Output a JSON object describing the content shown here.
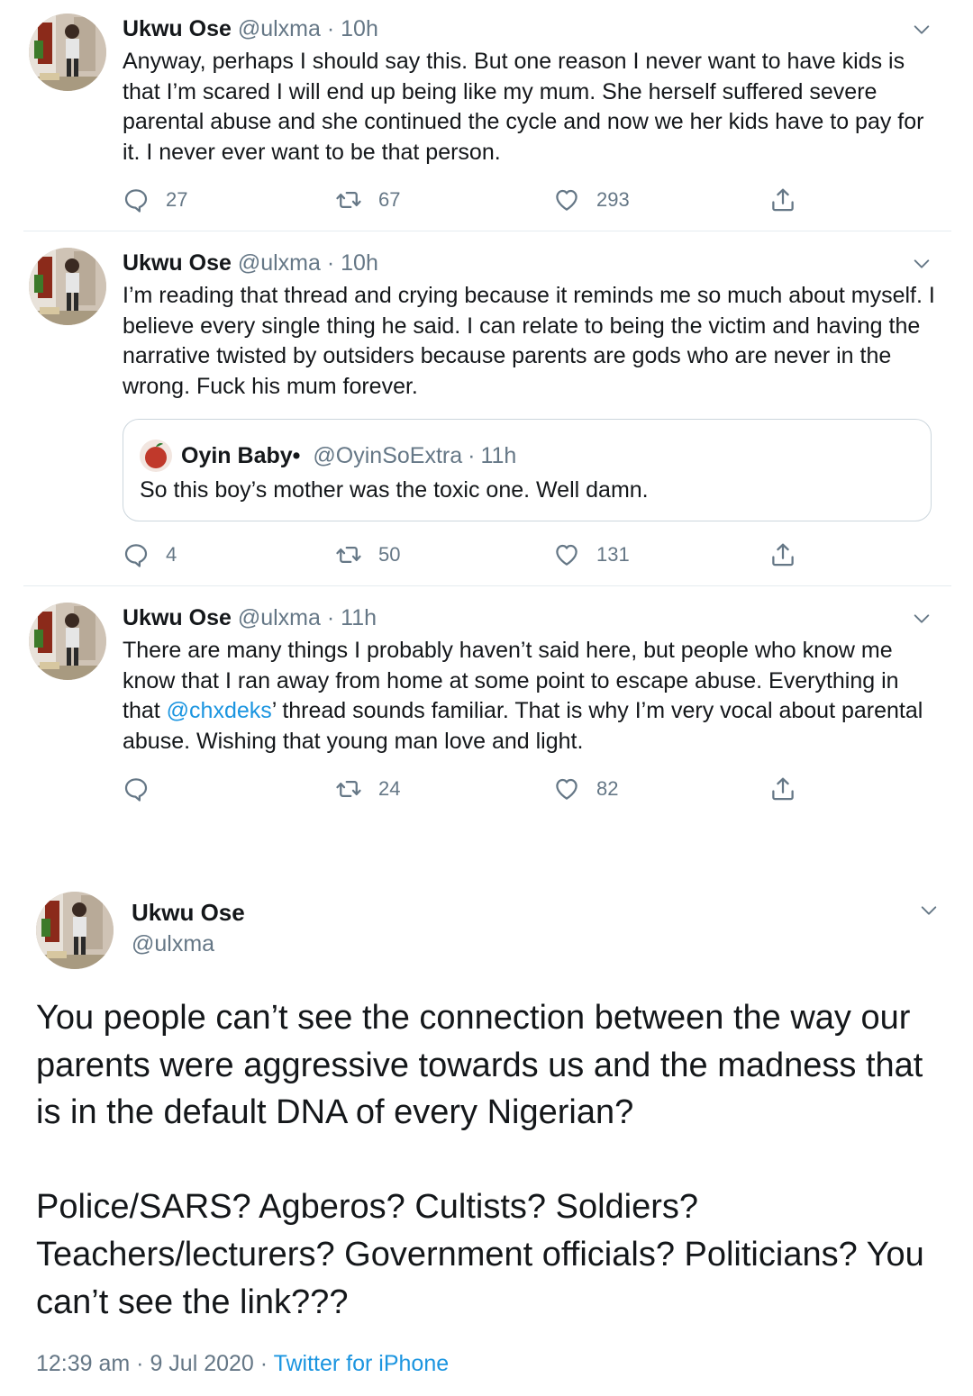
{
  "tweets": [
    {
      "name": "Ukwu Ose",
      "handle": "@ulxma",
      "time": "10h",
      "text": "Anyway, perhaps I should say this. But one reason I never want to have kids is that I’m scared I will end up being like my mum. She herself suffered severe parental abuse and she continued the cycle and now we her kids have to pay for it. I never ever want to be that person.",
      "replies": "27",
      "retweets": "67",
      "likes": "293"
    },
    {
      "name": "Ukwu Ose",
      "handle": "@ulxma",
      "time": "10h",
      "text": "I’m reading that thread and crying because it reminds me so much about myself. I believe every single thing he said. I can relate to being the victim and having the narrative twisted by outsiders because parents are gods who are never in the wrong. Fuck his mum forever.",
      "replies": "4",
      "retweets": "50",
      "likes": "131",
      "quote": {
        "name": "Oyin Baby•",
        "handle": "@OyinSoExtra",
        "time": "11h",
        "text": "So this boy’s mother was the toxic one. Well damn."
      }
    },
    {
      "name": "Ukwu Ose",
      "handle": "@ulxma",
      "time": "11h",
      "text_before": "There are many things I probably haven’t said here, but people who know me know that I ran away from home at some point to escape abuse. Everything in that ",
      "mention": "@chxdeks",
      "text_after": "’ thread sounds familiar. That is why I’m very vocal about parental abuse. Wishing that young man love and light.",
      "replies": "",
      "retweets": "24",
      "likes": "82"
    }
  ],
  "main_tweet": {
    "name": "Ukwu Ose",
    "handle": "@ulxma",
    "paragraph1": "You people can’t see the connection between the way our parents were aggressive towards us and the madness that is in the default DNA of every Nigerian?",
    "paragraph2": "Police/SARS? Agberos? Cultists? Soldiers? Teachers/lecturers? Government officials? Politicians? You can’t see the link???",
    "timestamp": "12:39 am · 9 Jul 2020 · ",
    "source": "Twitter for iPhone"
  },
  "icons": {
    "reply": "speech-bubble-icon",
    "retweet": "retweet-icon",
    "like": "heart-icon",
    "share": "share-upload-icon",
    "more": "chevron-down-icon"
  },
  "colors": {
    "link": "#1b95e0",
    "secondary_text": "#657786",
    "divider": "#e6ecf0"
  }
}
